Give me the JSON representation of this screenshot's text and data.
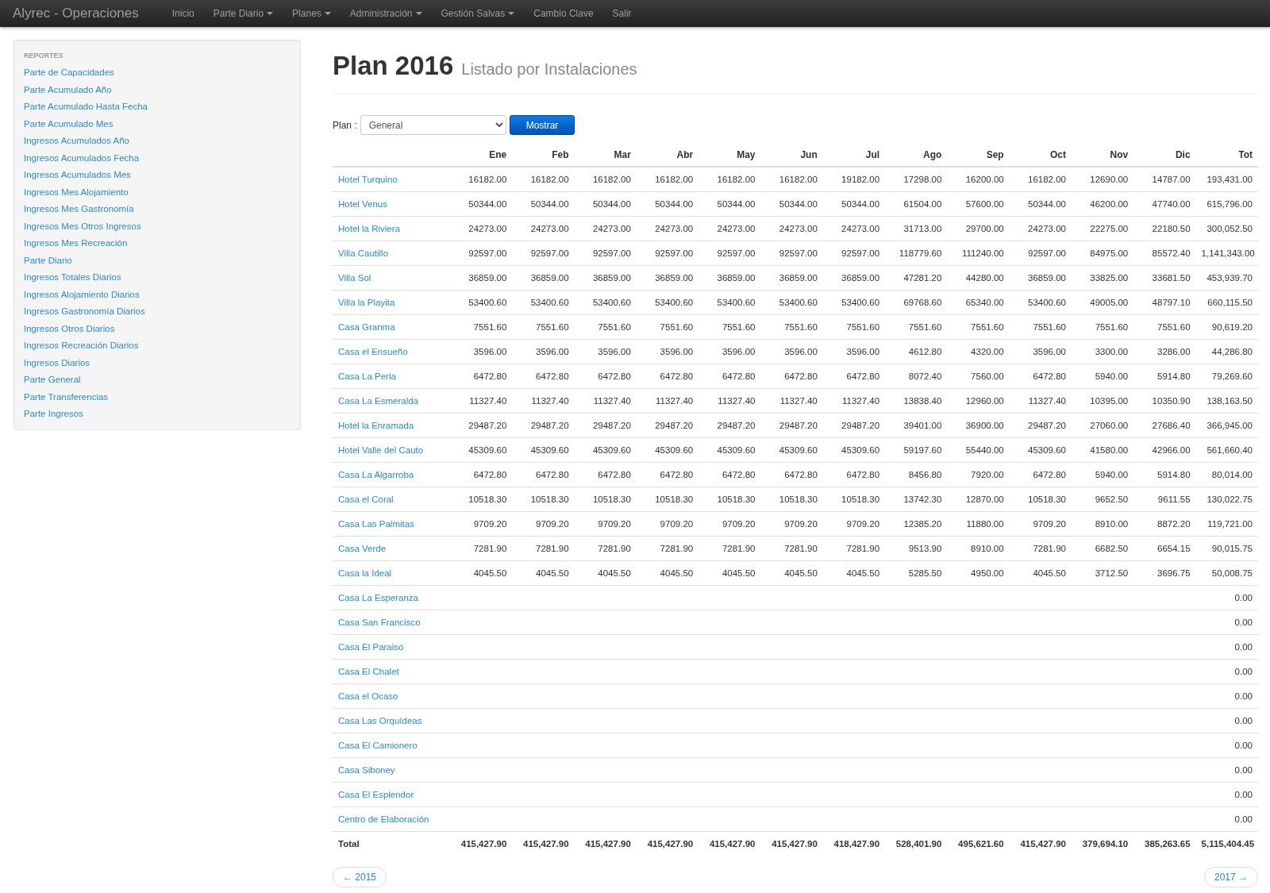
{
  "navbar": {
    "brand": "Alyrec - Operaciones",
    "items": [
      {
        "label": "Inicio",
        "dropdown": false
      },
      {
        "label": "Parte Diario",
        "dropdown": true
      },
      {
        "label": "Planes",
        "dropdown": true
      },
      {
        "label": "Administración",
        "dropdown": true
      },
      {
        "label": "Gestión Salvas",
        "dropdown": true
      },
      {
        "label": "Cambio Clave",
        "dropdown": false
      },
      {
        "label": "Salir",
        "dropdown": false
      }
    ]
  },
  "sidebar": {
    "heading": "REPORTES",
    "items": [
      "Parte de Capacidades",
      "Parte Acumulado Año",
      "Parte Acumulado Hasta Fecha",
      "Parte Acumulado Mes",
      "Ingresos Acumulados Año",
      "Ingresos Acumulados Fecha",
      "Ingresos Acumulados Mes",
      "Ingresos Mes Alojamiento",
      "Ingresos Mes Gastronomía",
      "Ingresos Mes Otros Ingresos",
      "Ingresos Mes Recreación",
      "Parte Diario",
      "Ingresos Totales Diarios",
      "Ingresos Alojamiento Diarios",
      "Ingresos Gastronomía Diarios",
      "Ingresos Otros Diarios",
      "Ingresos Recreación Diarios",
      "Ingresos Diarios",
      "Parte General",
      "Parte Transferencias",
      "Parte Ingresos"
    ]
  },
  "page": {
    "title": "Plan 2016",
    "subtitle": "Listado por Instalaciones"
  },
  "filter": {
    "label": "Plan :",
    "select_value": "General",
    "button": "Mostrar"
  },
  "table": {
    "columns": [
      "Ene",
      "Feb",
      "Mar",
      "Abr",
      "May",
      "Jun",
      "Jul",
      "Ago",
      "Sep",
      "Oct",
      "Nov",
      "Dic",
      "Tot"
    ],
    "rows": [
      {
        "name": "Hotel Turquino",
        "values": [
          "16182.00",
          "16182.00",
          "16182.00",
          "16182.00",
          "16182.00",
          "16182.00",
          "19182.00",
          "17298.00",
          "16200.00",
          "16182.00",
          "12690.00",
          "14787.00"
        ],
        "total": "193,431.00"
      },
      {
        "name": "Hotel Venus",
        "values": [
          "50344.00",
          "50344.00",
          "50344.00",
          "50344.00",
          "50344.00",
          "50344.00",
          "50344.00",
          "61504.00",
          "57600.00",
          "50344.00",
          "46200.00",
          "47740.00"
        ],
        "total": "615,796.00"
      },
      {
        "name": "Hotel la Riviera",
        "values": [
          "24273.00",
          "24273.00",
          "24273.00",
          "24273.00",
          "24273.00",
          "24273.00",
          "24273.00",
          "31713.00",
          "29700.00",
          "24273.00",
          "22275.00",
          "22180.50"
        ],
        "total": "300,052.50"
      },
      {
        "name": "Villa Cautillo",
        "values": [
          "92597.00",
          "92597.00",
          "92597.00",
          "92597.00",
          "92597.00",
          "92597.00",
          "92597.00",
          "118779.60",
          "111240.00",
          "92597.00",
          "84975.00",
          "85572.40"
        ],
        "total": "1,141,343.00"
      },
      {
        "name": "Villa Sol",
        "values": [
          "36859.00",
          "36859.00",
          "36859.00",
          "36859.00",
          "36859.00",
          "36859.00",
          "36859.00",
          "47281.20",
          "44280.00",
          "36859.00",
          "33825.00",
          "33681.50"
        ],
        "total": "453,939.70"
      },
      {
        "name": "Villa la Playita",
        "values": [
          "53400.60",
          "53400.60",
          "53400.60",
          "53400.60",
          "53400.60",
          "53400.60",
          "53400.60",
          "69768.60",
          "65340.00",
          "53400.60",
          "49005.00",
          "48797.10"
        ],
        "total": "660,115.50"
      },
      {
        "name": "Casa Granma",
        "values": [
          "7551.60",
          "7551.60",
          "7551.60",
          "7551.60",
          "7551.60",
          "7551.60",
          "7551.60",
          "7551.60",
          "7551.60",
          "7551.60",
          "7551.60",
          "7551.60"
        ],
        "total": "90,619.20"
      },
      {
        "name": "Casa el Ensueño",
        "values": [
          "3596.00",
          "3596.00",
          "3596.00",
          "3596.00",
          "3596.00",
          "3596.00",
          "3596.00",
          "4612.80",
          "4320.00",
          "3596.00",
          "3300.00",
          "3286.00"
        ],
        "total": "44,286.80"
      },
      {
        "name": "Casa La Perla",
        "values": [
          "6472.80",
          "6472.80",
          "6472.80",
          "6472.80",
          "6472.80",
          "6472.80",
          "6472.80",
          "8072.40",
          "7560.00",
          "6472.80",
          "5940.00",
          "5914.80"
        ],
        "total": "79,269.60"
      },
      {
        "name": "Casa La Esmeralda",
        "values": [
          "11327.40",
          "11327.40",
          "11327.40",
          "11327.40",
          "11327.40",
          "11327.40",
          "11327.40",
          "13838.40",
          "12960.00",
          "11327.40",
          "10395.00",
          "10350.90"
        ],
        "total": "138,163.50"
      },
      {
        "name": "Hotel la Enramada",
        "values": [
          "29487.20",
          "29487.20",
          "29487.20",
          "29487.20",
          "29487.20",
          "29487.20",
          "29487.20",
          "39401.00",
          "36900.00",
          "29487.20",
          "27060.00",
          "27686.40"
        ],
        "total": "366,945.00"
      },
      {
        "name": "Hotel Valle del Cauto",
        "values": [
          "45309.60",
          "45309.60",
          "45309.60",
          "45309.60",
          "45309.60",
          "45309.60",
          "45309.60",
          "59197.60",
          "55440.00",
          "45309.60",
          "41580.00",
          "42966.00"
        ],
        "total": "561,660.40"
      },
      {
        "name": "Casa La Algarroba",
        "values": [
          "6472.80",
          "6472.80",
          "6472.80",
          "6472.80",
          "6472.80",
          "6472.80",
          "6472.80",
          "8456.80",
          "7920.00",
          "6472.80",
          "5940.00",
          "5914.80"
        ],
        "total": "80,014.00"
      },
      {
        "name": "Casa el Coral",
        "values": [
          "10518.30",
          "10518.30",
          "10518.30",
          "10518.30",
          "10518.30",
          "10518.30",
          "10518.30",
          "13742.30",
          "12870.00",
          "10518.30",
          "9652.50",
          "9611.55"
        ],
        "total": "130,022.75"
      },
      {
        "name": "Casa Las Palmitas",
        "values": [
          "9709.20",
          "9709.20",
          "9709.20",
          "9709.20",
          "9709.20",
          "9709.20",
          "9709.20",
          "12385.20",
          "11880.00",
          "9709.20",
          "8910.00",
          "8872.20"
        ],
        "total": "119,721.00"
      },
      {
        "name": "Casa Verde",
        "values": [
          "7281.90",
          "7281.90",
          "7281.90",
          "7281.90",
          "7281.90",
          "7281.90",
          "7281.90",
          "9513.90",
          "8910.00",
          "7281.90",
          "6682.50",
          "6654.15"
        ],
        "total": "90,015.75"
      },
      {
        "name": "Casa la Ideal",
        "values": [
          "4045.50",
          "4045.50",
          "4045.50",
          "4045.50",
          "4045.50",
          "4045.50",
          "4045.50",
          "5285.50",
          "4950.00",
          "4045.50",
          "3712.50",
          "3696.75"
        ],
        "total": "50,008.75"
      },
      {
        "name": "Casa La Esperanza",
        "total": "0.00"
      },
      {
        "name": "Casa San Francisco",
        "total": "0.00"
      },
      {
        "name": "Casa El Paraiso",
        "total": "0.00"
      },
      {
        "name": "Casa El Chalet",
        "total": "0.00"
      },
      {
        "name": "Casa el Ocaso",
        "total": "0.00"
      },
      {
        "name": "Casa Las Orquídeas",
        "total": "0.00"
      },
      {
        "name": "Casa El Camionero",
        "total": "0.00"
      },
      {
        "name": "Casa Siboney",
        "total": "0.00"
      },
      {
        "name": "Casa El Esplendor",
        "total": "0.00"
      },
      {
        "name": "Centro de Elaboración",
        "total": "0.00"
      }
    ],
    "footer": {
      "label": "Total",
      "values": [
        "415,427.90",
        "415,427.90",
        "415,427.90",
        "415,427.90",
        "415,427.90",
        "415,427.90",
        "418,427.90",
        "528,401.90",
        "495,621.60",
        "415,427.90",
        "379,694.10",
        "385,263.65"
      ],
      "total": "5,115,404.45"
    }
  },
  "pager": {
    "previous": "← 2015",
    "next": "2017 →"
  }
}
